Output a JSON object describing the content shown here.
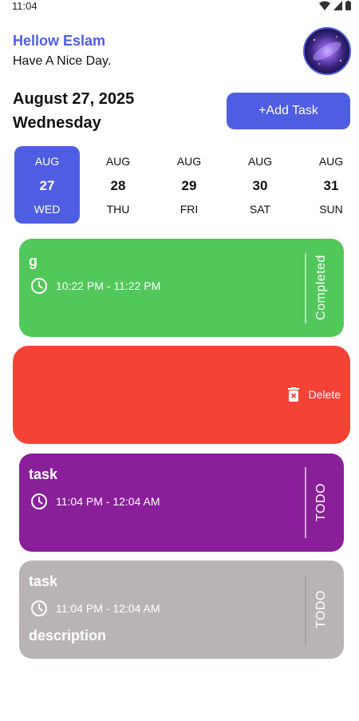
{
  "status_bar": {
    "time": "11:04"
  },
  "header": {
    "greeting": "Hellow Eslam",
    "subtitle": "Have A Nice Day."
  },
  "date_section": {
    "date": "August 27, 2025",
    "weekday": "Wednesday",
    "add_button": "+Add Task"
  },
  "date_strip": [
    {
      "month": "AUG",
      "day": "27",
      "weekday": "WED",
      "selected": true
    },
    {
      "month": "AUG",
      "day": "28",
      "weekday": "THU"
    },
    {
      "month": "AUG",
      "day": "29",
      "weekday": "FRI"
    },
    {
      "month": "AUG",
      "day": "30",
      "weekday": "SAT"
    },
    {
      "month": "AUG",
      "day": "31",
      "weekday": "SUN"
    }
  ],
  "tasks": [
    {
      "title": "g",
      "time": "10:22 PM - 11:22 PM",
      "status": "Completed",
      "color": "#52c85a"
    },
    {
      "title": "task",
      "time": "11:04 PM - 12:04 AM",
      "status": "TODO",
      "color": "#8a1f9a"
    },
    {
      "title": "task",
      "time": "11:04 PM - 12:04 AM",
      "description": "description",
      "status": "TODO",
      "color": "#b9b4b4"
    }
  ],
  "swipe_action": {
    "label": "Delete",
    "color": "#f44336"
  },
  "colors": {
    "accent": "#4f5de3"
  }
}
